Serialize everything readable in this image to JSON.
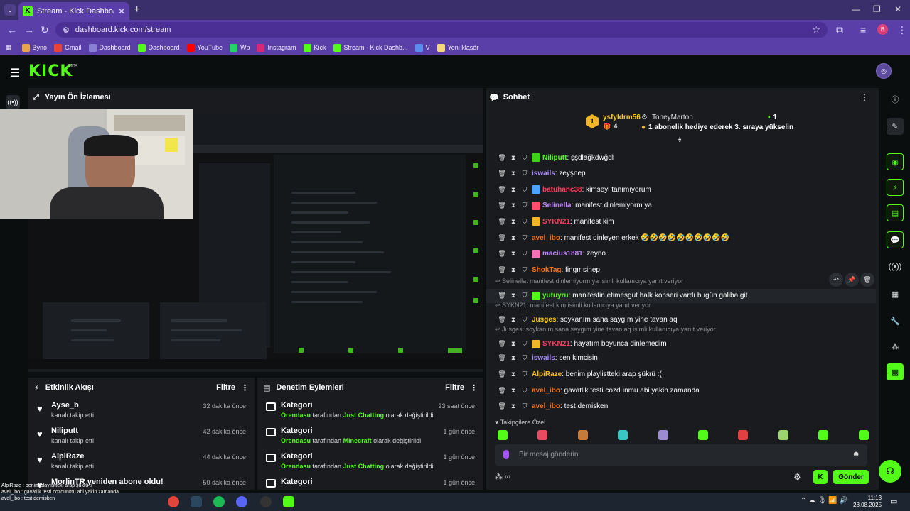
{
  "browser": {
    "tab_title": "Stream - Kick Dashboard",
    "url": "dashboard.kick.com/stream",
    "profile_initial": "B",
    "bookmarks": [
      {
        "label": "Byno",
        "color": "#e8a54b"
      },
      {
        "label": "Gmail",
        "color": "#ea4335"
      },
      {
        "label": "Dashboard",
        "color": "#8a7fd4"
      },
      {
        "label": "Dashboard",
        "color": "#53fc18"
      },
      {
        "label": "YouTube",
        "color": "#ff0000"
      },
      {
        "label": "Wp",
        "color": "#25d366"
      },
      {
        "label": "Instagram",
        "color": "#d62976"
      },
      {
        "label": "Kick",
        "color": "#53fc18"
      },
      {
        "label": "Stream - Kick Dashb...",
        "color": "#53fc18"
      },
      {
        "label": "V",
        "color": "#5a8dee"
      },
      {
        "label": "Yeni klasör",
        "color": "#f5d67a"
      }
    ]
  },
  "kick": {
    "logo": "KICK",
    "beta": "BETA"
  },
  "preview": {
    "title": "Yayın Ön İzlemesi"
  },
  "activity": {
    "title": "Etkinlik Akışı",
    "filter": "Filtre",
    "items": [
      {
        "name": "Ayse_b",
        "sub": "kanalı takip etti",
        "time": "32 dakika önce"
      },
      {
        "name": "Niliputt",
        "sub": "kanalı takip etti",
        "time": "42 dakika önce"
      },
      {
        "name": "AlpiRaze",
        "sub": "kanalı takip etti",
        "time": "44 dakika önce"
      },
      {
        "name": "MorlinTR yeniden abone oldu!",
        "sub": "",
        "time": "50 dakika önce"
      }
    ]
  },
  "moderation": {
    "title": "Denetim Eylemleri",
    "filter": "Filtre",
    "items": [
      {
        "title": "Kategori",
        "actor": "Orendasu",
        "mid": " tarafından ",
        "category": "Just Chatting",
        "tail": " olarak değiştirildi",
        "time": "23 saat önce"
      },
      {
        "title": "Kategori",
        "actor": "Orendasu",
        "mid": " tarafından ",
        "category": "Minecraft",
        "tail": " olarak değiştirildi",
        "time": "1 gün önce"
      },
      {
        "title": "Kategori",
        "actor": "Orendasu",
        "mid": " tarafından ",
        "category": "Just Chatting",
        "tail": " olarak değiştirildi",
        "time": "1 gün önce"
      },
      {
        "title": "Kategori",
        "actor": "",
        "mid": "",
        "category": "",
        "tail": "",
        "time": "1 gün önce"
      }
    ]
  },
  "chat": {
    "title": "Sohbet",
    "pinned": {
      "rank": "1",
      "gifter": "ysfyldrm56",
      "gift_count": "4",
      "user": "ToneyMarton",
      "user_count": "1",
      "message": "1 abonelik hediye ederek 3. sıraya yükselin"
    },
    "messages": [
      {
        "user": "Niliputt",
        "color": "#53fc18",
        "text": ": şşdlağkdwğdl",
        "badge": "#3fd11a"
      },
      {
        "user": "iswails",
        "color": "#a78bfa",
        "text": ": zeyşnep",
        "badge": ""
      },
      {
        "user": "batuhanc38",
        "color": "#ff3b5c",
        "text": ": kimseyi tanımıyorum",
        "badge": "#4aa3ff"
      },
      {
        "user": "Selinella",
        "color": "#c084fc",
        "text": ": manifest dinlemiyorm ya",
        "badge": "#ff4d6d"
      },
      {
        "user": "SYKN21",
        "color": "#ff3b5c",
        "text": ": manifest kim",
        "badge": "#f0b429"
      },
      {
        "user": "avel_ibo",
        "color": "#f97316",
        "text": ": manifest dinleyen erkek 🤣🤣🤣🤣🤣🤣🤣🤣🤣🤣",
        "badge": ""
      },
      {
        "user": "macius1881",
        "color": "#c084fc",
        "text": ": zeyno",
        "badge": "#f472b6"
      },
      {
        "user": "ShokTag",
        "color": "#f97316",
        "text": ": fingır sinep",
        "badge": ""
      },
      {
        "user": "yutuyru",
        "color": "#53fc18",
        "text": ": manifestin etimesgut halk konseri vardı bugün galiba git",
        "badge": "#53fc18",
        "reply": "Selinella: manifest dinlemiyorm ya isimli kullanıcıya yanıt veriyor"
      },
      {
        "user": "Jusges",
        "color": "#facc15",
        "text": ": soykanım sana saygım yine tavan aq",
        "badge": "",
        "reply": "SYKN21: manifest kim isimli kullanıcıya yanıt veriyor"
      },
      {
        "user": "SYKN21",
        "color": "#ff3b5c",
        "text": ": hayatım boyunca dinlemedim",
        "badge": "#f0b429",
        "reply": "Jusges: soykanım sana saygım yine tavan aq isimli kullanıcıya yanıt veriyor"
      },
      {
        "user": "iswails",
        "color": "#a78bfa",
        "text": ": sen kimcisin",
        "badge": ""
      },
      {
        "user": "AlpiRaze",
        "color": "#fbbf24",
        "text": ": benim playlistteki arap şükrü :(",
        "badge": ""
      },
      {
        "user": "avel_ibo",
        "color": "#f97316",
        "text": ": gavatlik testi cozdunmu abi yakin zamanda",
        "badge": ""
      },
      {
        "user": "avel_ibo",
        "color": "#f97316",
        "text": ": test demisken",
        "badge": ""
      }
    ],
    "followers_only": "Takipçilere Özel",
    "input_placeholder": "Bir mesaj gönderin",
    "send": "Gönder",
    "points": "∞"
  },
  "taskbar": {
    "time": "11:13",
    "date": "28.08.2025",
    "overlay_lines": [
      "AlpiRaze : benim playlistteki arap şükrü :(",
      "avel_ibo : gavatlik testi cozdunmu abi yakin zamanda",
      "avel_ibo : test demisken"
    ]
  }
}
